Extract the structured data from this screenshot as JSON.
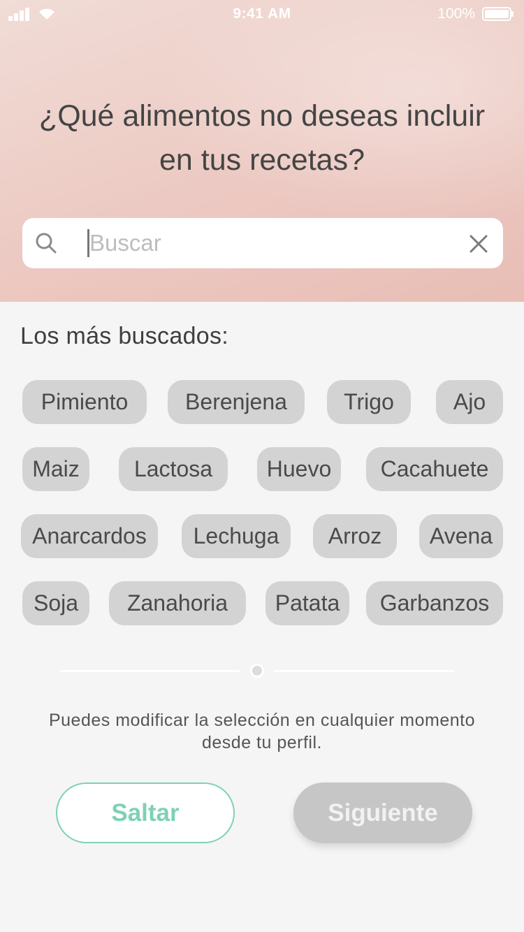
{
  "status_bar": {
    "time": "9:41 AM",
    "battery": "100%"
  },
  "header": {
    "title": "¿Qué alimentos no deseas incluir en tus recetas?"
  },
  "search": {
    "placeholder": "Buscar",
    "value": ""
  },
  "popular": {
    "label": "Los más buscados:",
    "chips": [
      "Pimiento",
      "Berenjena",
      "Trigo",
      "Ajo",
      "Maiz",
      "Lactosa",
      "Huevo",
      "Cacahuete",
      "Anarcardos",
      "Lechuga",
      "Arroz",
      "Avena",
      "Soja",
      "Zanahoria",
      "Patata",
      "Garbanzos"
    ]
  },
  "footer": {
    "note": "Puedes modificar la selección en cualquier momento desde tu perfil.",
    "skip_label": "Saltar",
    "next_label": "Siguiente"
  },
  "colors": {
    "accent": "#7fd1b3",
    "chip_bg": "#d3d3d3",
    "disabled_button": "#c6c6c6"
  }
}
